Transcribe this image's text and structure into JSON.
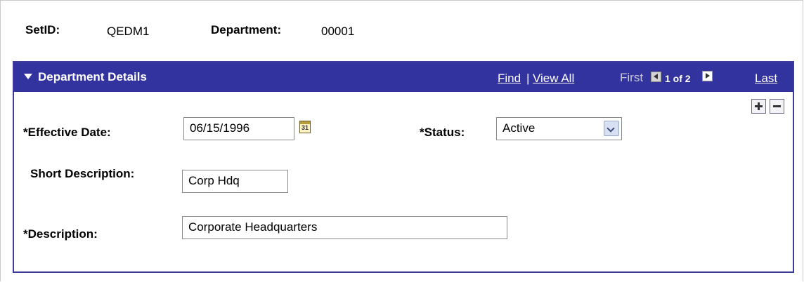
{
  "header": {
    "setid_label": "SetID:",
    "setid_value": "QEDM1",
    "department_label": "Department:",
    "department_value": "00001"
  },
  "panel": {
    "title": "Department Details",
    "find": "Find",
    "separator": "|",
    "view_all": "View All",
    "first": "First",
    "count": "1 of 2",
    "last": "Last"
  },
  "form": {
    "effective_date_label": "*Effective Date:",
    "effective_date_value": "06/15/1996",
    "status_label": "*Status:",
    "status_value": "Active",
    "short_description_label": "Short Description:",
    "short_description_value": "Corp Hdq",
    "description_label": "*Description:",
    "description_value": "Corporate Headquarters",
    "calendar_glyph": "31"
  },
  "icons": {
    "collapse": "triangle-down-icon",
    "prev": "prev-row-icon",
    "next": "next-row-icon",
    "calendar": "calendar-icon",
    "add_row": "plus-icon",
    "delete_row": "minus-icon",
    "dropdown": "chevron-down-icon"
  },
  "colors": {
    "bar_background": "#3333a0",
    "bar_text": "#ffffff"
  }
}
